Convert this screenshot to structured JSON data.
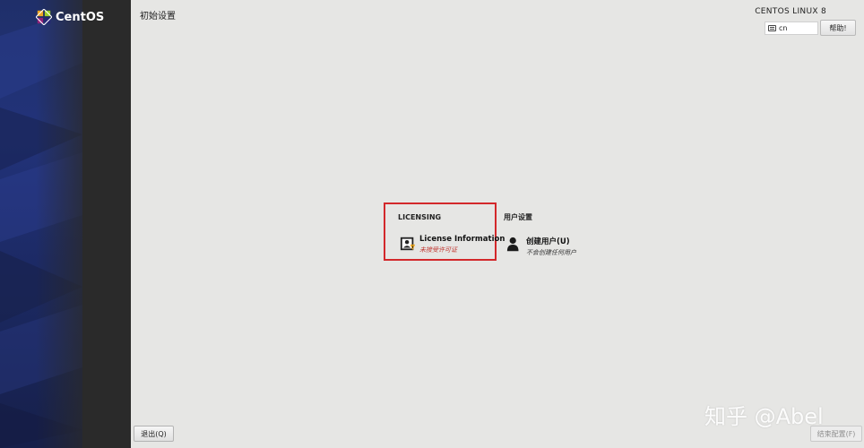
{
  "sidebar": {
    "logo_text": "CentOS"
  },
  "header": {
    "page_title": "初始设置",
    "product_title": "CENTOS LINUX 8",
    "keyboard_layout": "cn",
    "help_label": "帮助!"
  },
  "categories": [
    {
      "title": "LICENSING",
      "spokes": [
        {
          "title": "License Information",
          "status": "未接受许可证",
          "icon": "license-icon",
          "status_color": "#c0332d"
        }
      ]
    },
    {
      "title": "用户设置",
      "spokes": [
        {
          "title": "创建用户(U)",
          "status": "不会创建任何用户",
          "icon": "user-icon",
          "status_color": "#333333"
        }
      ]
    }
  ],
  "footer": {
    "quit_label": "退出(Q)",
    "finish_label": "结束配置(F)"
  },
  "watermark": "知乎 @Abel",
  "colors": {
    "highlight": "#d3282b",
    "sidebar_bg": "#2a2a2a",
    "sidebar_band": "#22337a",
    "content_bg": "#e6e6e4"
  }
}
